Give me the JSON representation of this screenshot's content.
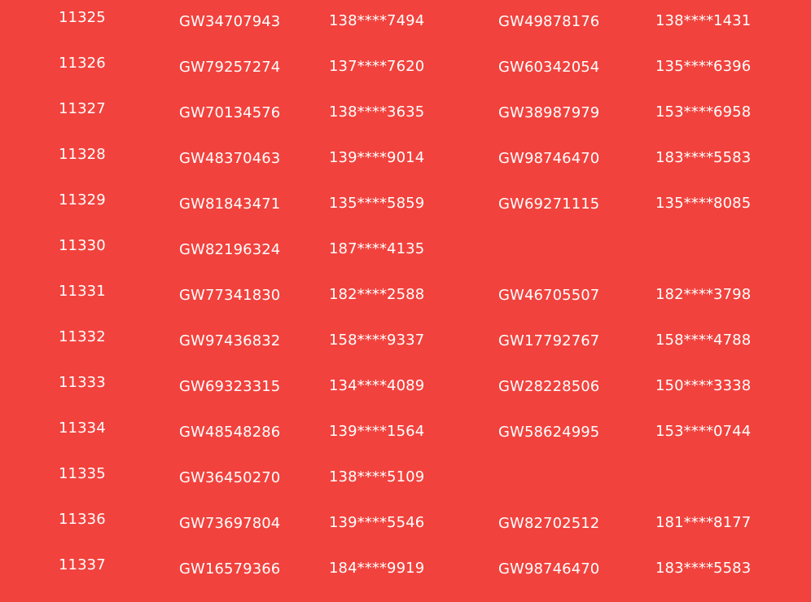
{
  "rows": [
    {
      "no": "11325",
      "code1": "GW34707943",
      "phone1": "138****7494",
      "code2": "GW49878176",
      "phone2": "138****1431"
    },
    {
      "no": "11326",
      "code1": "GW79257274",
      "phone1": "137****7620",
      "code2": "GW60342054",
      "phone2": "135****6396"
    },
    {
      "no": "11327",
      "code1": "GW70134576",
      "phone1": "138****3635",
      "code2": "GW38987979",
      "phone2": "153****6958"
    },
    {
      "no": "11328",
      "code1": "GW48370463",
      "phone1": "139****9014",
      "code2": "GW98746470",
      "phone2": "183****5583"
    },
    {
      "no": "11329",
      "code1": "GW81843471",
      "phone1": "135****5859",
      "code2": "GW69271115",
      "phone2": "135****8085"
    },
    {
      "no": "11330",
      "code1": "GW82196324",
      "phone1": "187****4135",
      "code2": "",
      "phone2": ""
    },
    {
      "no": "11331",
      "code1": "GW77341830",
      "phone1": "182****2588",
      "code2": "GW46705507",
      "phone2": "182****3798"
    },
    {
      "no": "11332",
      "code1": "GW97436832",
      "phone1": "158****9337",
      "code2": "GW17792767",
      "phone2": "158****4788"
    },
    {
      "no": "11333",
      "code1": "GW69323315",
      "phone1": "134****4089",
      "code2": "GW28228506",
      "phone2": "150****3338"
    },
    {
      "no": "11334",
      "code1": "GW48548286",
      "phone1": "139****1564",
      "code2": "GW58624995",
      "phone2": "153****0744"
    },
    {
      "no": "11335",
      "code1": "GW36450270",
      "phone1": "138****5109",
      "code2": "",
      "phone2": ""
    },
    {
      "no": "11336",
      "code1": "GW73697804",
      "phone1": "139****5546",
      "code2": "GW82702512",
      "phone2": "181****8177"
    },
    {
      "no": "11337",
      "code1": "GW16579366",
      "phone1": "184****9919",
      "code2": "GW98746470",
      "phone2": "183****5583"
    }
  ]
}
